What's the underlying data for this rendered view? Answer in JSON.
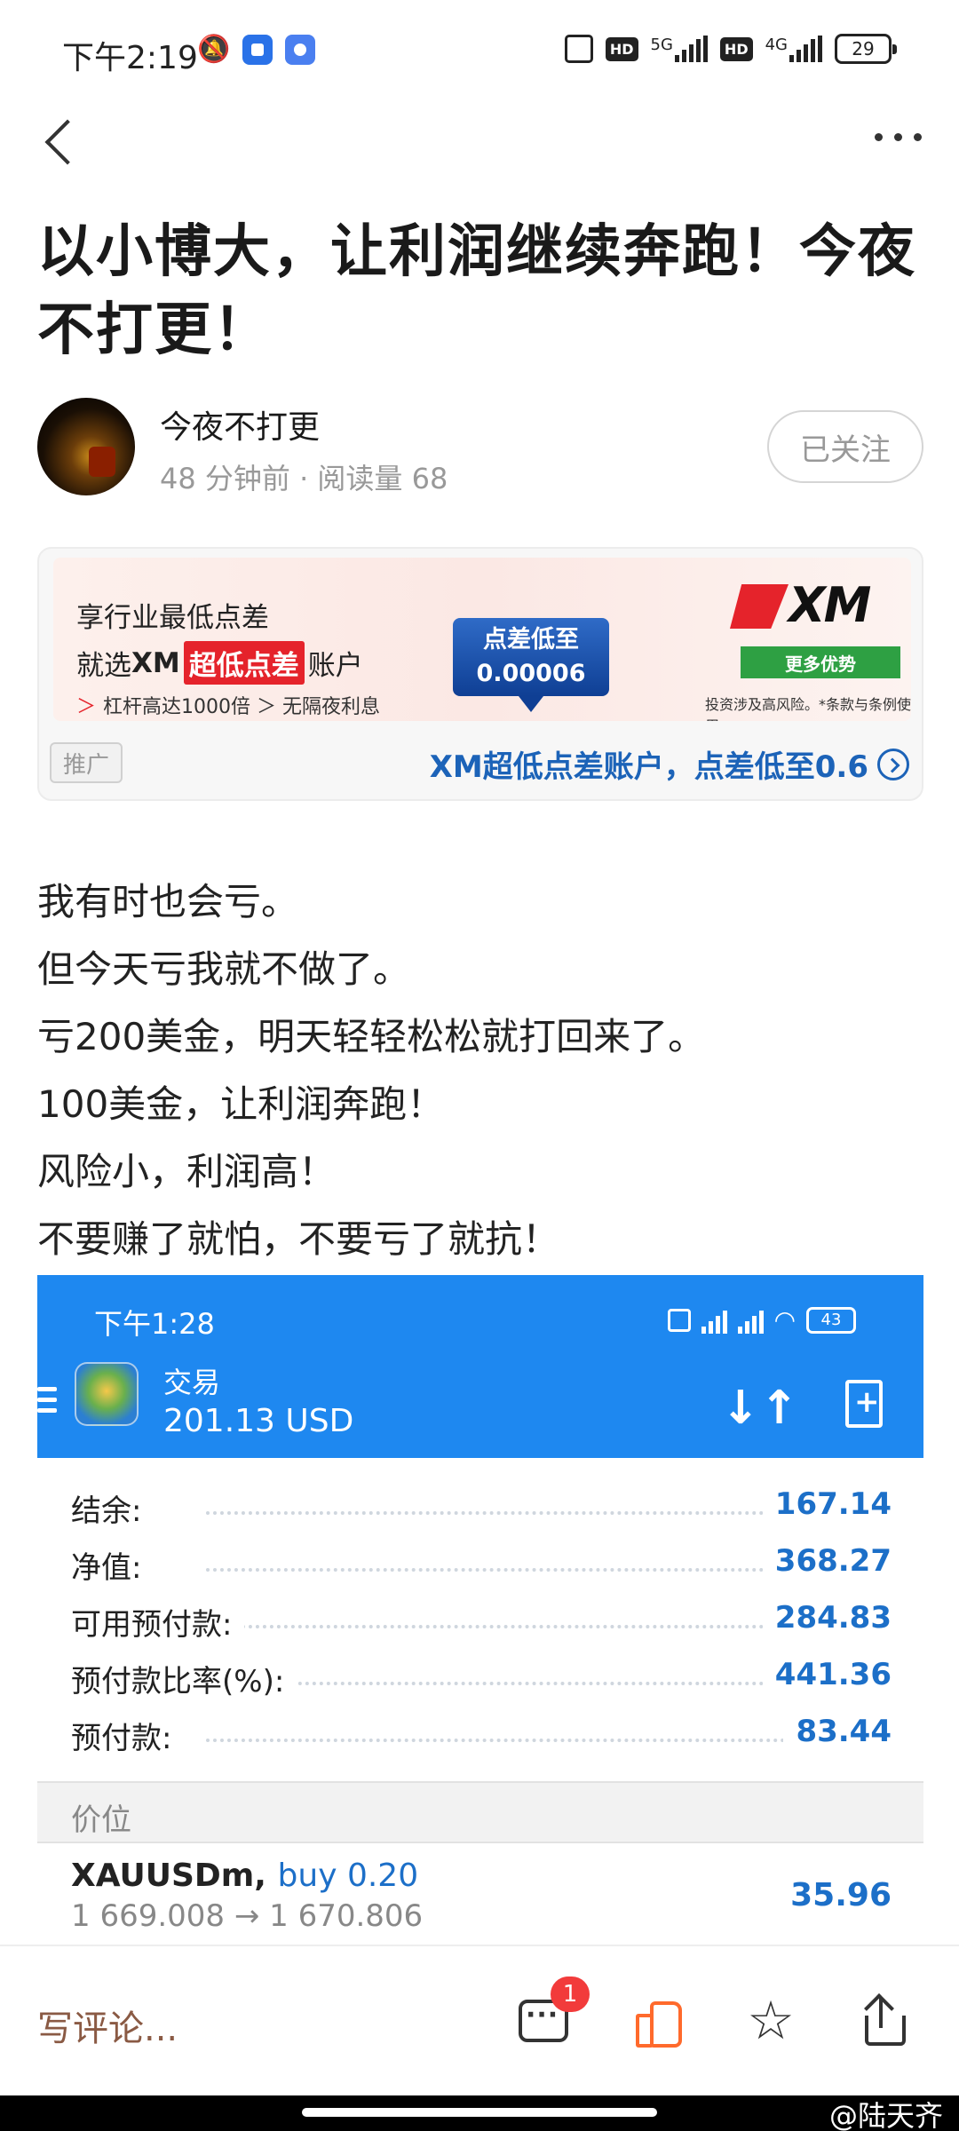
{
  "status_bar": {
    "time": "下午2:19",
    "icons": [
      "mute-icon",
      "app-icon",
      "browser-icon",
      "screen-icon",
      "hd-icon",
      "signal-5g-icon",
      "hd-icon",
      "signal-4g-icon",
      "battery-icon"
    ],
    "network_1": "5G",
    "network_2": "4G",
    "hd": "HD",
    "battery": "29"
  },
  "article": {
    "title": "以小博大，让利润继续奔跑！今夜不打更！",
    "author": "今夜不打更",
    "meta": "48 分钟前 · 阅读量 68",
    "follow_label": "已关注",
    "body": [
      "我有时也会亏。",
      "但今天亏我就不做了。",
      "亏200美金，明天轻轻松松就打回来了。",
      "100美金，让利润奔跑！",
      "风险小，利润高！",
      "不要赚了就怕，不要亏了就抗！"
    ]
  },
  "ad": {
    "line1": "享行业最低点差",
    "line2_pre": "就选",
    "line2_brand": "XM",
    "line2_highlight": "超低点差",
    "line2_post": "账户",
    "line3": "杠杆高达1000倍 ＞ 无隔夜利息",
    "box_line1": "点差低至",
    "box_line2": "0.00006",
    "logo_text": "XM",
    "more_label": "更多优势",
    "note": "投资涉及高风险。*条款与条例使用。",
    "tag": "推广",
    "link_text": "XM超低点差账户，点差低至0.6"
  },
  "embedded": {
    "time": "下午1:28",
    "battery": "43",
    "title": "交易",
    "balance": "201.13 USD",
    "rows": [
      {
        "label": "结余:",
        "value": "167.14"
      },
      {
        "label": "净值:",
        "value": "368.27"
      },
      {
        "label": "可用预付款:",
        "value": "284.83"
      },
      {
        "label": "预付款比率(%):",
        "value": "441.36"
      },
      {
        "label": "预付款:",
        "value": "83.44"
      }
    ],
    "section": "价位",
    "position": {
      "symbol": "XAUUSDm,",
      "side": "buy 0.20",
      "prices": "1 669.008 → 1 670.806",
      "profit": "35.96"
    }
  },
  "bottom": {
    "comment_placeholder": "写评论...",
    "badge": "1",
    "watermark": "@陆天齐"
  }
}
